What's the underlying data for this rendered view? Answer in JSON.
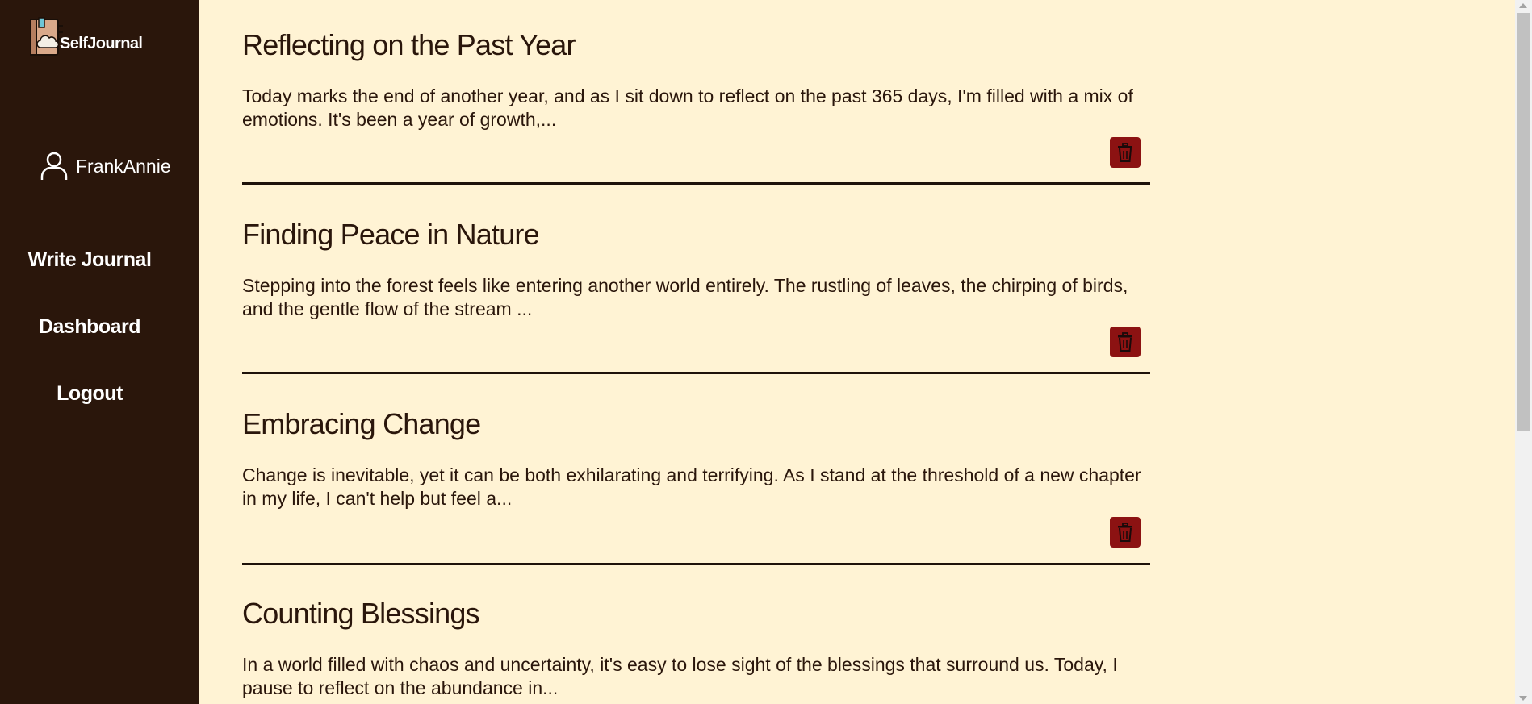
{
  "app": {
    "brand_name": "SelfJournal"
  },
  "user": {
    "name": "FrankAnnie"
  },
  "nav": {
    "write": "Write Journal",
    "dashboard": "Dashboard",
    "logout": "Logout"
  },
  "entries": [
    {
      "title": "Reflecting on the Past Year",
      "excerpt": "Today marks the end of another year, and as I sit down to reflect on the past 365 days, I'm filled with a mix of emotions. It's been a year of growth,..."
    },
    {
      "title": "Finding Peace in Nature",
      "excerpt": "Stepping into the forest feels like entering another world entirely. The rustling of leaves, the chirping of birds, and the gentle flow of the stream ..."
    },
    {
      "title": "Embracing Change",
      "excerpt": "Change is inevitable, yet it can be both exhilarating and terrifying. As I stand at the threshold of a new chapter in my life, I can't help but feel a..."
    },
    {
      "title": "Counting Blessings",
      "excerpt": "In a world filled with chaos and uncertainty, it's easy to lose sight of the blessings that surround us. Today, I pause to reflect on the abundance in..."
    }
  ],
  "icons": {
    "logo": "journal-logo-icon",
    "user": "user-icon",
    "delete": "trash-icon"
  },
  "colors": {
    "sidebar": "#2a160b",
    "background": "#fff3d4",
    "delete_button": "#8c1212",
    "text": "#2a160b"
  }
}
